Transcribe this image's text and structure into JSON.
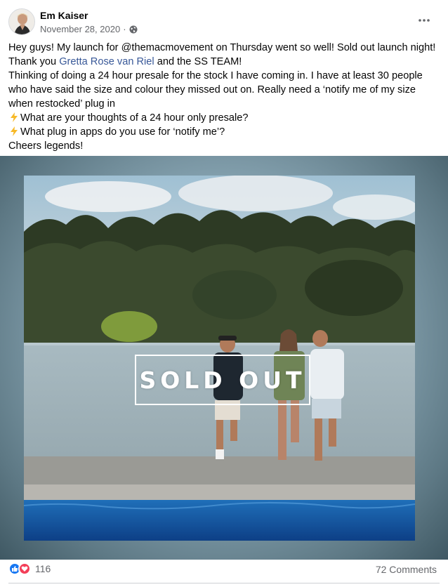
{
  "post": {
    "author": "Em Kaiser",
    "date": "November 28, 2020",
    "separator": "·",
    "privacy_icon": "globe-icon",
    "more_icon": "more-options-icon",
    "text": {
      "line1_pre": "Hey guys! My launch for @themacmovement on Thursday went so well! Sold out launch night! Thank you ",
      "mention": "Gretta Rose van Riel",
      "line1_post": " and the SS TEAM!",
      "line2": "Thinking of doing a 24 hour presale for the stock I have coming in. I have at least 30 people who have said the size and colour they missed out on. Really need a ‘notify me of my size when restocked’ plug in",
      "bullet1": "What are your thoughts of a 24 hour only presale?",
      "bullet2": "What plug in apps do you use for ‘notify me’?",
      "signoff": "Cheers legends!"
    },
    "image": {
      "overlay_text": "SOLD OUT"
    }
  },
  "footer": {
    "reaction_count": "116",
    "reactions": [
      "like",
      "love"
    ],
    "comments_label": "72 Comments"
  },
  "colors": {
    "mention": "#385898",
    "like": "#1877f2",
    "love": "#f33e58",
    "muted": "#65676b"
  }
}
